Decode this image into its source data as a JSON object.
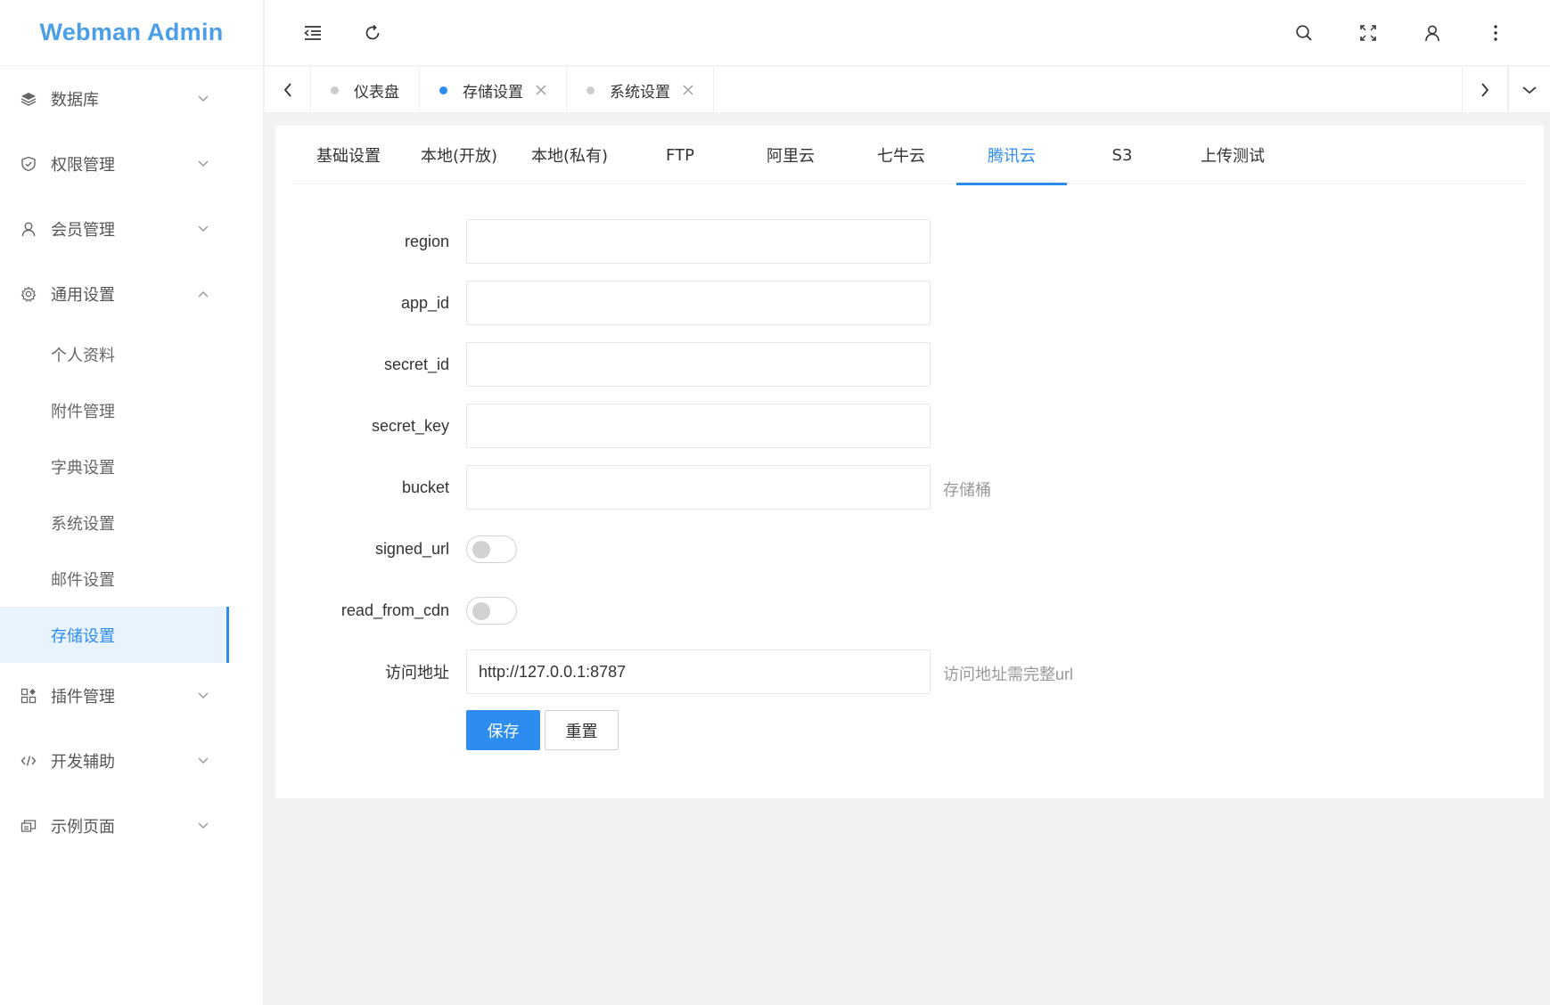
{
  "app": {
    "title": "Webman Admin"
  },
  "sidebar": {
    "items": [
      {
        "label": "数据库",
        "icon": "layers-icon"
      },
      {
        "label": "权限管理",
        "icon": "shield-icon"
      },
      {
        "label": "会员管理",
        "icon": "user-icon"
      },
      {
        "label": "通用设置",
        "icon": "gear-icon",
        "expanded": true
      }
    ],
    "submenu": [
      {
        "label": "个人资料"
      },
      {
        "label": "附件管理"
      },
      {
        "label": "字典设置"
      },
      {
        "label": "系统设置"
      },
      {
        "label": "邮件设置"
      },
      {
        "label": "存储设置",
        "active": true
      }
    ],
    "items_after": [
      {
        "label": "插件管理",
        "icon": "grid-icon"
      },
      {
        "label": "开发辅助",
        "icon": "code-icon"
      },
      {
        "label": "示例页面",
        "icon": "pages-icon"
      }
    ]
  },
  "header": {
    "icons": [
      "menu-fold-icon",
      "refresh-icon",
      "search-icon",
      "fullscreen-icon",
      "user-icon",
      "more-icon"
    ]
  },
  "tabbar": {
    "tabs": [
      {
        "label": "仪表盘",
        "closable": false
      },
      {
        "label": "存储设置",
        "closable": true,
        "active": true
      },
      {
        "label": "系统设置",
        "closable": true
      }
    ]
  },
  "subtabs": [
    "基础设置",
    "本地(开放)",
    "本地(私有)",
    "FTP",
    "阿里云",
    "七牛云",
    "腾讯云",
    "S3",
    "上传测试"
  ],
  "active_subtab": "腾讯云",
  "form": {
    "region": {
      "label": "region",
      "value": ""
    },
    "app_id": {
      "label": "app_id",
      "value": ""
    },
    "secret_id": {
      "label": "secret_id",
      "value": ""
    },
    "secret_key": {
      "label": "secret_key",
      "value": ""
    },
    "bucket": {
      "label": "bucket",
      "value": "",
      "hint": "存储桶"
    },
    "signed_url": {
      "label": "signed_url",
      "checked": false
    },
    "read_from_cdn": {
      "label": "read_from_cdn",
      "checked": false
    },
    "url": {
      "label": "访问地址",
      "value": "http://127.0.0.1:8787",
      "hint": "访问地址需完整url"
    },
    "save_label": "保存",
    "reset_label": "重置"
  },
  "colors": {
    "accent": "#2d8cf0",
    "logo": "#4a9fe8",
    "background": "#f2f2f2"
  }
}
